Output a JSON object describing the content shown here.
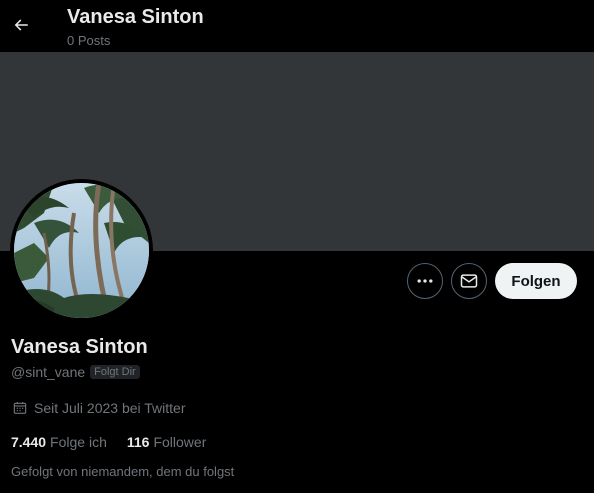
{
  "header": {
    "name": "Vanesa Sinton",
    "posts_count": "0 Posts"
  },
  "profile": {
    "display_name": "Vanesa Sinton",
    "handle": "@sint_vane",
    "follows_you_badge": "Folgt Dir",
    "joined": "Seit Juli 2023 bei Twitter",
    "following_count": "7.440",
    "following_label": "Folge ich",
    "followers_count": "116",
    "followers_label": "Follower",
    "followed_by": "Gefolgt von niemandem, dem du folgst"
  },
  "actions": {
    "more_icon": "more-icon",
    "message_icon": "mail-icon",
    "follow_label": "Folgen"
  },
  "colors": {
    "background": "#000000",
    "banner": "#333639",
    "text_primary": "#e7e9ea",
    "text_secondary": "#71767b",
    "follow_button_bg": "#eff3f4"
  }
}
